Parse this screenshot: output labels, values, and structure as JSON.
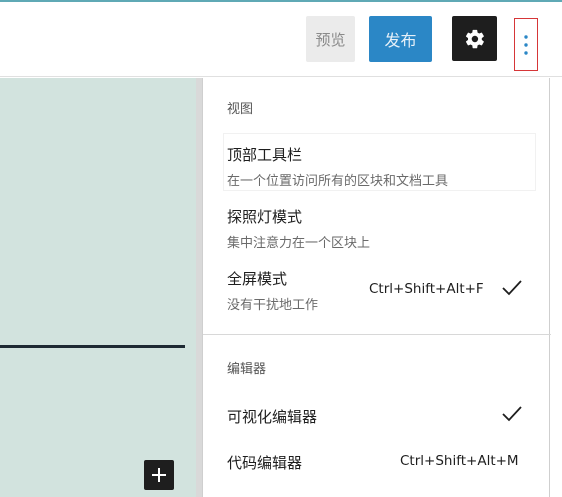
{
  "toolbar": {
    "preview_label": "预览",
    "publish_label": "发布",
    "settings_icon": "gear-icon",
    "more_icon": "vertical-ellipsis-icon"
  },
  "canvas": {
    "add_block_icon": "plus-icon"
  },
  "menu": {
    "view_section": {
      "title": "视图",
      "items": [
        {
          "label": "顶部工具栏",
          "description": "在一个位置访问所有的区块和文档工具"
        },
        {
          "label": "探照灯模式",
          "description": "集中注意力在一个区块上"
        },
        {
          "label": "全屏模式",
          "description": "没有干扰地工作",
          "shortcut": "Ctrl+Shift+Alt+F",
          "checked": true
        }
      ]
    },
    "editor_section": {
      "title": "编辑器",
      "items": [
        {
          "label": "可视化编辑器",
          "checked": true
        },
        {
          "label": "代码编辑器",
          "shortcut": "Ctrl+Shift+Alt+M"
        }
      ]
    }
  },
  "colors": {
    "publish": "#2b87c6",
    "canvas": "#d2e3de",
    "highlight_border": "#d63638"
  }
}
